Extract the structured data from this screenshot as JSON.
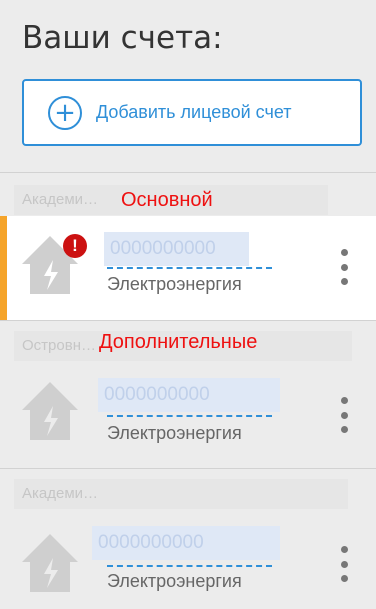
{
  "header": {
    "title": "Ваши счета:"
  },
  "add_account": {
    "label": "Добавить лицевой счет",
    "icon": "plus-circle-icon"
  },
  "sections": [
    {
      "label": "Основной",
      "address": "Академи…",
      "accounts": [
        {
          "number": "0000000000",
          "service": "Электроэнергия",
          "alert": "!",
          "icon": "house-lightning-icon"
        }
      ]
    },
    {
      "label": "Дополнительные",
      "address": "Островн…",
      "accounts": [
        {
          "number": "0000000000",
          "service": "Электроэнергия",
          "icon": "house-lightning-icon"
        }
      ]
    },
    {
      "label": "",
      "address": "Академи…",
      "accounts": [
        {
          "number": "0000000000",
          "service": "Электроэнергия",
          "icon": "house-lightning-icon"
        }
      ]
    }
  ],
  "colors": {
    "accent": "#2f8fd8",
    "primary_marker": "#f5a42a",
    "label_red": "#ee1111",
    "alert": "#cc1111"
  }
}
